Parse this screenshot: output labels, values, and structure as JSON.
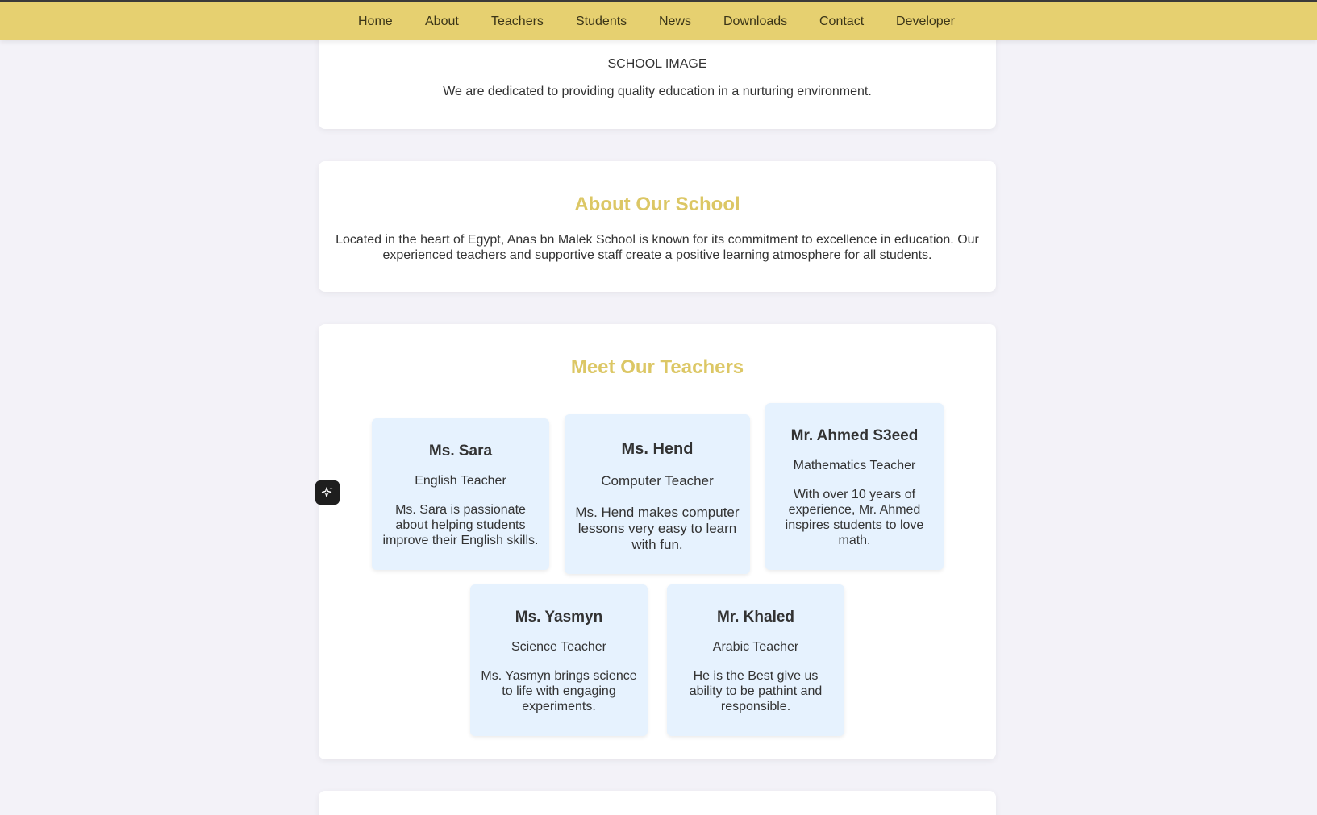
{
  "nav": {
    "items": [
      "Home",
      "About",
      "Teachers",
      "Students",
      "News",
      "Downloads",
      "Contact",
      "Developer"
    ]
  },
  "hero": {
    "image_alt": "SCHOOL IMAGE",
    "tagline": "We are dedicated to providing quality education in a nurturing environment."
  },
  "about": {
    "title": "About Our School",
    "text": "Located in the heart of Egypt, Anas bn Malek School is known for its commitment to excellence in education. Our experienced teachers and supportive staff create a positive learning atmosphere for all students."
  },
  "teachers": {
    "title": "Meet Our Teachers",
    "list": [
      {
        "name": "Ms. Sara",
        "role": "English Teacher",
        "desc": "Ms. Sara is passionate about helping students improve their English skills."
      },
      {
        "name": "Ms. Hend",
        "role": "Computer Teacher",
        "desc": "Ms. Hend makes computer lessons very easy to learn with fun."
      },
      {
        "name": "Mr. Ahmed S3eed",
        "role": "Mathematics Teacher",
        "desc": "With over 10 years of experience, Mr. Ahmed inspires students to love math."
      },
      {
        "name": "Ms. Yasmyn",
        "role": "Science Teacher",
        "desc": "Ms. Yasmyn brings science to life with engaging experiments."
      },
      {
        "name": "Mr. Khaled",
        "role": "Arabic Teacher",
        "desc": "He is the Best give us ability to be pathint and responsible."
      }
    ]
  },
  "colors": {
    "nav_bg": "#e6d070",
    "accent_title": "#dcc765",
    "teacher_card_bg": "#e6f2fe",
    "page_bg": "#f3f2f8"
  },
  "icons": {
    "floating_button": "sparkle-icon"
  }
}
